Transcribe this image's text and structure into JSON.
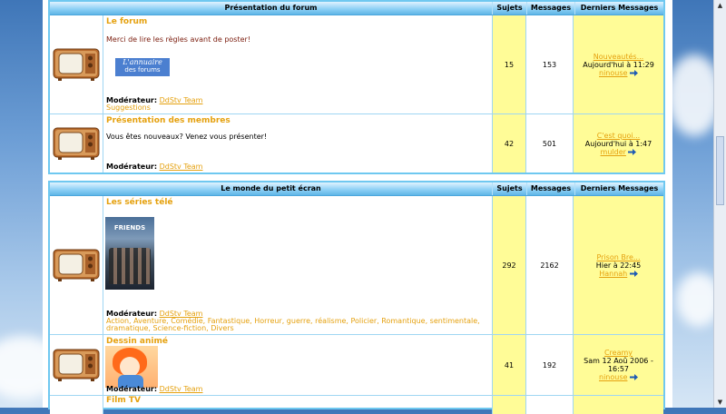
{
  "scrollbar": {
    "up": "▲",
    "down": "▼"
  },
  "sections": [
    {
      "header": {
        "title": "Présentation du forum",
        "subjects": "Sujets",
        "messages": "Messages",
        "last": "Derniers Messages"
      },
      "forums": [
        {
          "name": "Le forum",
          "description": "Merci de lire les règles avant de poster!",
          "banner_line1": "L'annuaire",
          "banner_line2": "des forums",
          "mod_label": "Modérateur:",
          "mods": "DdStv Team",
          "subforums": "Suggestions",
          "subjects": "15",
          "messages": "153",
          "last_title": "Nouveautés...",
          "last_date": "Aujourd'hui à 11:29",
          "last_user": "ninouse"
        },
        {
          "name": "Présentation des membres",
          "description": "Vous êtes nouveaux? Venez vous présenter!",
          "mod_label": "Modérateur:",
          "mods": "DdStv Team",
          "subjects": "42",
          "messages": "501",
          "last_title": "C'est quoi...",
          "last_date": "Aujourd'hui à 1:47",
          "last_user": "mulder"
        }
      ]
    },
    {
      "header": {
        "title": "Le monde du petit écran",
        "subjects": "Sujets",
        "messages": "Messages",
        "last": "Derniers Messages"
      },
      "forums": [
        {
          "name": "Les séries télé",
          "poster_text": "FRIENDS",
          "mod_label": "Modérateur:",
          "mods": "DdStv Team",
          "subforums_line1": "Action, Aventure, Comédie, Fantastique, Horreur, guerre, réalisme, Policier, Romantique, sentimentale,",
          "subforums_line2": "dramatique, Science-fiction, Divers",
          "subjects": "292",
          "messages": "2162",
          "last_title": "Prison Bre...",
          "last_date": "Hier à 22:45",
          "last_user": "Hannah"
        },
        {
          "name": "Dessin animé",
          "mod_label": "Modérateur:",
          "mods": "DdStv Team",
          "subjects": "41",
          "messages": "192",
          "last_title": "Creamy",
          "last_date": "Sam 12 Aoû 2006 - 16:57",
          "last_user": "ninouse"
        },
        {
          "name": "Film TV"
        }
      ]
    }
  ],
  "colors": {
    "accent": "#e5a10f",
    "header_blue": "#6fc8f0",
    "stats_yellow": "#fffc97",
    "description": "#7a1b0c"
  }
}
